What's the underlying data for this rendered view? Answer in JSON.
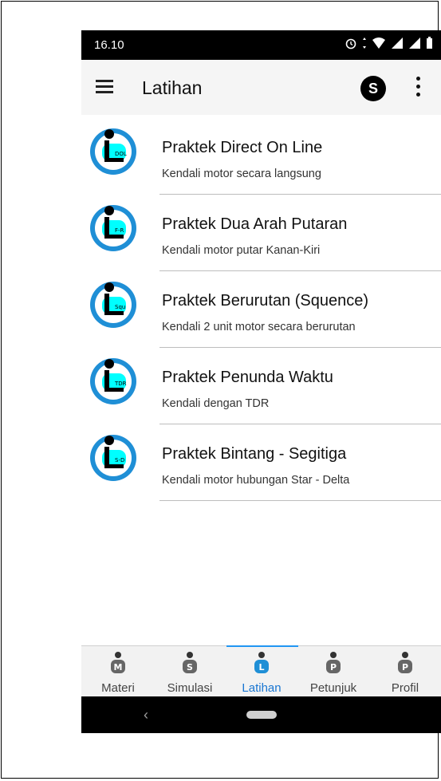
{
  "status": {
    "time": "16.10"
  },
  "appbar": {
    "title": "Latihan",
    "avatar_letter": "S"
  },
  "items": [
    {
      "title": "Praktek Direct On Line",
      "subtitle": "Kendali motor secara langsung",
      "badge": "DOL"
    },
    {
      "title": "Praktek Dua Arah Putaran",
      "subtitle": "Kendali motor putar Kanan-Kiri",
      "badge": "F-R"
    },
    {
      "title": "Praktek Berurutan (Squence)",
      "subtitle": "Kendali 2 unit motor secara berurutan",
      "badge": "Squ"
    },
    {
      "title": "Praktek Penunda Waktu",
      "subtitle": "Kendali dengan TDR",
      "badge": "TDR"
    },
    {
      "title": "Praktek Bintang - Segitiga",
      "subtitle": "Kendali motor hubungan Star - Delta",
      "badge": "S-D"
    }
  ],
  "bottomnav": {
    "items": [
      {
        "label": "Materi",
        "letter": "M"
      },
      {
        "label": "Simulasi",
        "letter": "S"
      },
      {
        "label": "Latihan",
        "letter": "L"
      },
      {
        "label": "Petunjuk",
        "letter": "P"
      },
      {
        "label": "Profil",
        "letter": "P"
      }
    ],
    "active_index": 2
  },
  "colors": {
    "accent": "#1976d2",
    "logo_ring": "#1f8fd6",
    "logo_fill": "#00ffff"
  }
}
